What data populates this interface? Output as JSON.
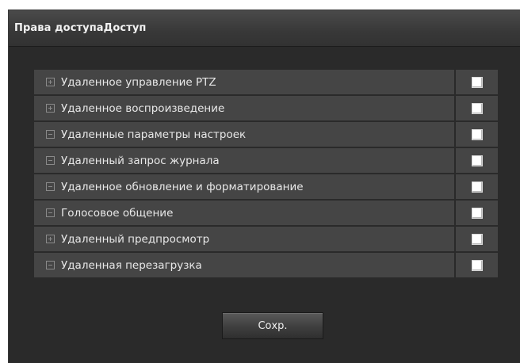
{
  "panel": {
    "title": "Права доступаДоступ"
  },
  "permissions": [
    {
      "label": "Удаленное управление PTZ",
      "expander": "plus",
      "checked": false
    },
    {
      "label": "Удаленное воспроизведение",
      "expander": "plus",
      "checked": false
    },
    {
      "label": "Удаленные параметры настроек",
      "expander": "minus",
      "checked": false
    },
    {
      "label": "Удаленный запрос журнала",
      "expander": "minus",
      "checked": false
    },
    {
      "label": "Удаленное обновление и форматирование",
      "expander": "minus",
      "checked": false
    },
    {
      "label": "Голосовое общение",
      "expander": "minus",
      "checked": false
    },
    {
      "label": "Удаленный предпросмотр",
      "expander": "plus",
      "checked": false
    },
    {
      "label": "Удаленная перезагрузка",
      "expander": "minus",
      "checked": false
    }
  ],
  "save_label": "Сохр.",
  "colors": {
    "panel_bg": "#2a2a2a",
    "row_bg": "#454545",
    "text": "#e8e8e8"
  }
}
